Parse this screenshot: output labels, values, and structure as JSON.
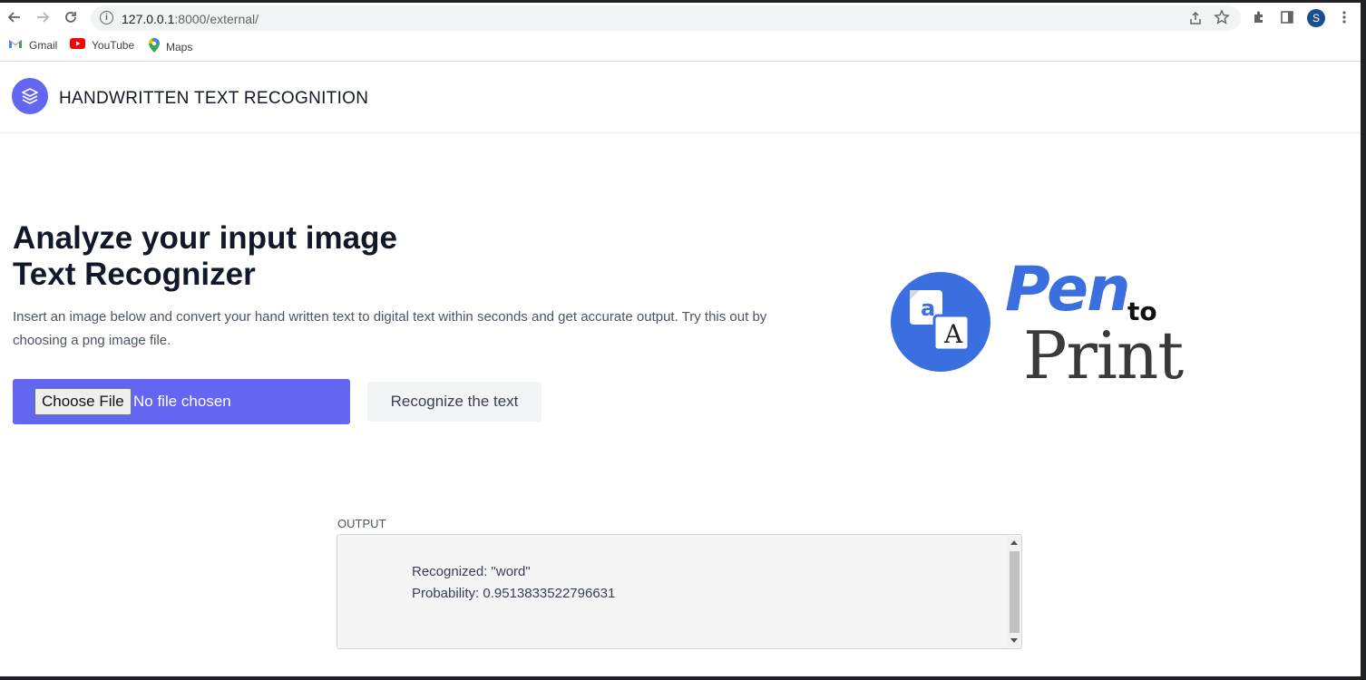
{
  "browser": {
    "url_host": "127.0.0.1",
    "url_rest": ":8000/external/",
    "avatar_letter": "S",
    "icons": [
      "back-icon",
      "forward-icon",
      "reload-icon",
      "site-info-icon",
      "share-icon",
      "star-icon",
      "extensions-icon",
      "side-panel-icon",
      "menu-icon"
    ]
  },
  "bookmarks": [
    {
      "label": "Gmail",
      "icon": "gmail-icon"
    },
    {
      "label": "YouTube",
      "icon": "youtube-icon"
    },
    {
      "label": "Maps",
      "icon": "maps-icon"
    }
  ],
  "app": {
    "title": "HANDWRITTEN TEXT RECOGNITION",
    "accent": "#6366f1"
  },
  "hero": {
    "title_line1": "Analyze your input image",
    "title_line2": "Text Recognizer",
    "description": "Insert an image below and convert your hand written text to digital text within seconds and get accurate output. Try this out by choosing a png image file."
  },
  "upload": {
    "choose_label": "Choose File",
    "file_status": "No file chosen",
    "recognize_label": "Recognize the text"
  },
  "logo": {
    "pen": "Pen",
    "to": "to",
    "print": "Print",
    "badge_small": "a",
    "badge_large": "A",
    "pen_color": "#3b6fe0"
  },
  "output": {
    "label": "OUTPUT",
    "recognized": "Recognized: \"word\"",
    "probability": "Probability: 0.9513833522796631"
  }
}
